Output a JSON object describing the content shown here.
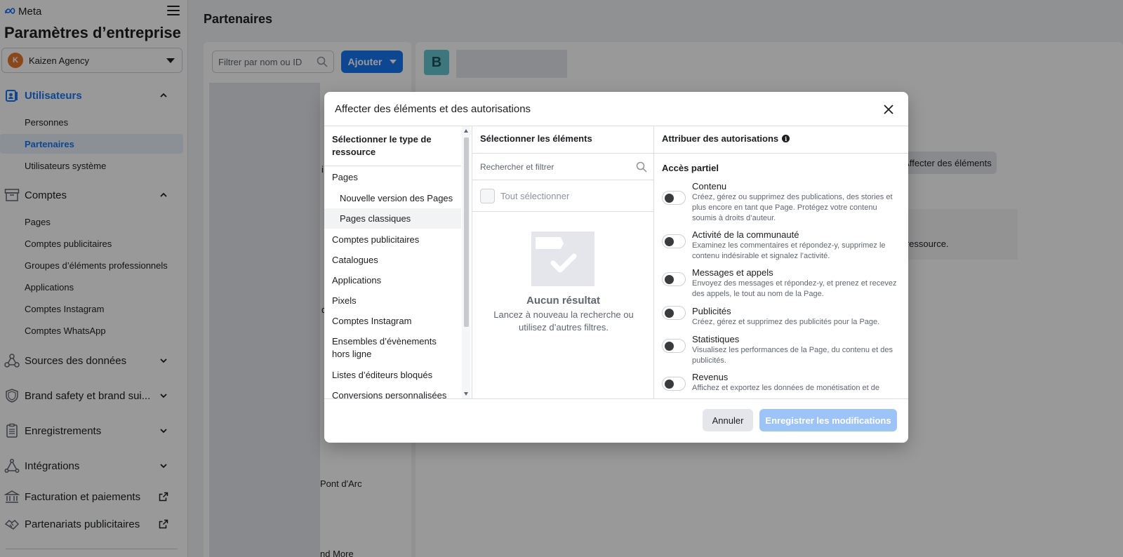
{
  "sidebar": {
    "brand": "Meta",
    "title": "Paramètres d’entreprise",
    "business": {
      "name": "Kaizen Agency",
      "avatar_letter": "K"
    },
    "sections": [
      {
        "label": "Utilisateurs",
        "icon": "users-icon",
        "expanded": true,
        "items": [
          {
            "label": "Personnes"
          },
          {
            "label": "Partenaires",
            "selected": true
          },
          {
            "label": "Utilisateurs système"
          }
        ]
      },
      {
        "label": "Comptes",
        "icon": "archive-icon",
        "expanded": true,
        "items": [
          {
            "label": "Pages"
          },
          {
            "label": "Comptes publicitaires"
          },
          {
            "label": "Groupes d’éléments professionnels"
          },
          {
            "label": "Applications"
          },
          {
            "label": "Comptes Instagram"
          },
          {
            "label": "Comptes WhatsApp"
          }
        ]
      },
      {
        "label": "Sources des données",
        "icon": "data-sources-icon"
      },
      {
        "label": "Brand safety et brand sui...",
        "icon": "shield-icon"
      },
      {
        "label": "Enregistrements",
        "icon": "clipboard-icon"
      },
      {
        "label": "Intégrations",
        "icon": "integrations-icon"
      },
      {
        "label": "Facturation et paiements",
        "icon": "bank-icon"
      },
      {
        "label": "Partenariats publicitaires",
        "icon": "handshake-icon"
      }
    ]
  },
  "main": {
    "title": "Partenaires",
    "filter_placeholder": "Filtrer par nom ou ID",
    "add_label": "Ajouter",
    "partner_initial": "B",
    "assign_label": "Affecter des éléments",
    "info_text": "e ressource.",
    "bg_fragments": [
      "i",
      "d",
      "Pont d'Arc",
      "nd More"
    ]
  },
  "modal": {
    "title": "Affecter des éléments et des autorisations",
    "col1": {
      "header": "Sélectionner le type de ressource",
      "items": [
        {
          "label": "Pages"
        },
        {
          "label": "Nouvelle version des Pages",
          "sub": true
        },
        {
          "label": "Pages classiques",
          "sub": true,
          "highlighted": true
        },
        {
          "label": "Comptes publicitaires"
        },
        {
          "label": "Catalogues"
        },
        {
          "label": "Applications"
        },
        {
          "label": "Pixels"
        },
        {
          "label": "Comptes Instagram"
        },
        {
          "label": "Ensembles d’évènements hors ligne"
        },
        {
          "label": "Listes d’éditeurs bloqués"
        },
        {
          "label": "Conversions personnalisées"
        }
      ]
    },
    "col2": {
      "header": "Sélectionner les éléments",
      "search_placeholder": "Rechercher et filtrer",
      "select_all": "Tout sélectionner",
      "empty_title": "Aucun résultat",
      "empty_sub": "Lancez à nouveau la recherche ou utilisez d’autres filtres."
    },
    "col3": {
      "header": "Attribuer des autorisations",
      "access_label": "Accès partiel",
      "permissions": [
        {
          "title": "Contenu",
          "desc": "Créez, gérez ou supprimez des publications, des stories et plus encore en tant que Page. Protégez votre contenu soumis à droits d’auteur.",
          "on": false
        },
        {
          "title": "Activité de la communauté",
          "desc": "Examinez les commentaires et répondez-y, supprimez le contenu indésirable et signalez l’activité.",
          "on": false
        },
        {
          "title": "Messages et appels",
          "desc": "Envoyez des messages et répondez-y, et prenez et recevez des appels, le tout au nom de la Page.",
          "on": false
        },
        {
          "title": "Publicités",
          "desc": "Créez, gérez et supprimez des publicités pour la Page.",
          "on": false
        },
        {
          "title": "Statistiques",
          "desc": "Visualisez les performances de la Page, du contenu et des publicités.",
          "on": false
        },
        {
          "title": "Revenus",
          "desc": "Affichez et exportez les données de monétisation et de",
          "on": false
        }
      ]
    },
    "cancel_label": "Annuler",
    "save_label": "Enregistrer les modifications"
  },
  "colors": {
    "accent": "#1877f2",
    "save_disabled": "#9cc4f8",
    "partner_avatar": "#63c7d0"
  }
}
